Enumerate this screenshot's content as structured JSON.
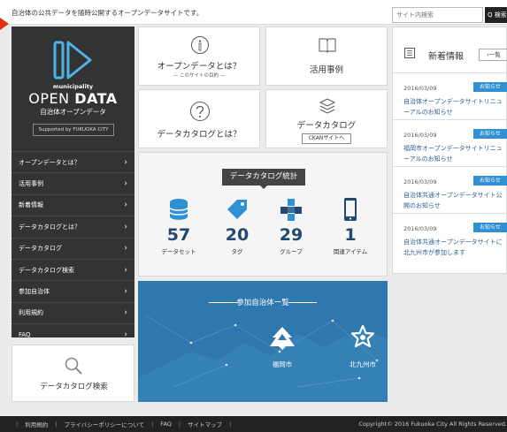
{
  "header": {
    "tagline": "自治体の公共データを随時公開するオープンデータサイトです。",
    "search_placeholder": "サイト内検索",
    "search_button": "Q 検索"
  },
  "sidebar": {
    "logo_small": "municipality",
    "logo_open": "OPEN ",
    "logo_data": "DATA",
    "logo_sub": "自治体オープンデータ",
    "supported": "Supported by FUKUOKA CITY",
    "items": [
      {
        "label": "オープンデータとは？"
      },
      {
        "label": "活用事例"
      },
      {
        "label": "新着情報"
      },
      {
        "label": "データカタログとは？"
      },
      {
        "label": "データカタログ"
      },
      {
        "label": "データカタログ検索"
      },
      {
        "label": "参加自治体"
      },
      {
        "label": "利用規約"
      },
      {
        "label": "FAQ"
      }
    ]
  },
  "left_search": {
    "label": "データカタログ検索"
  },
  "cards": {
    "about_title": "オープンデータとは？",
    "about_sub": "— このサイトの目的 —",
    "cases_title": "活用事例",
    "catalog_q_title": "データカタログとは？",
    "catalog_title": "データカタログ",
    "ckan_label": "CKANサイトへ"
  },
  "stats": {
    "title": "データカタログ統計",
    "items": [
      {
        "value": "57",
        "label": "データセット",
        "icon": "database-icon"
      },
      {
        "value": "20",
        "label": "タグ",
        "icon": "tag-icon"
      },
      {
        "value": "29",
        "label": "グループ",
        "icon": "group-icon"
      },
      {
        "value": "1",
        "label": "関連アイテム",
        "icon": "phone-icon"
      }
    ]
  },
  "municipalities": {
    "title": "参加自治体一覧",
    "items": [
      {
        "name": "福岡市",
        "icon": "fukuoka-emblem-icon"
      },
      {
        "name": "北九州市",
        "icon": "kitakyushu-emblem-icon"
      }
    ]
  },
  "news": {
    "title": "新着情報",
    "list_button": "一覧",
    "items": [
      {
        "date": "2016/03/09",
        "badge": "お知らせ",
        "text": "自治体オープンデータサイトリニューアルのお知らせ"
      },
      {
        "date": "2016/03/09",
        "badge": "お知らせ",
        "text": "福岡市オープンデータサイトリニューアルのお知らせ"
      },
      {
        "date": "2016/03/09",
        "badge": "お知らせ",
        "text": "自治体共通オープンデータサイト公開のお知らせ"
      },
      {
        "date": "2016/03/09",
        "badge": "お知らせ",
        "text": "自治体共通オープンデータサイトに北九州市が参加します"
      }
    ]
  },
  "footer": {
    "links": [
      "利用規約",
      "プライバシーポリシーについて",
      "FAQ",
      "サイトマップ"
    ],
    "copyright": "Copyright© 2016 Fukuoka City All Rights Reserved."
  },
  "colors": {
    "accent": "#2f78ad",
    "badge": "#2f90d3",
    "sidebar": "#333333",
    "pointer": "#e4300f"
  }
}
